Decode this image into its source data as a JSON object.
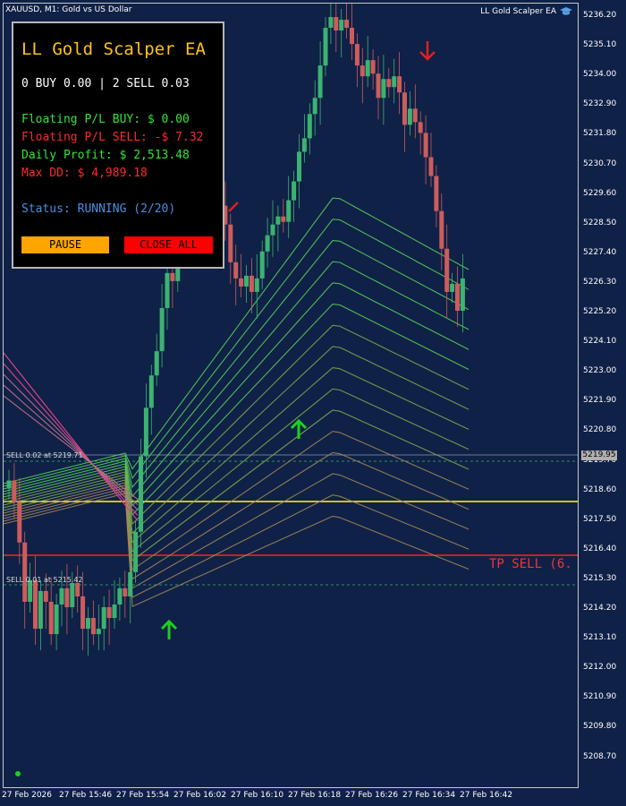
{
  "header": {
    "symbol": "XAUUSD, M1:  Gold vs US Dollar",
    "ea_name": "LL Gold Scalper EA",
    "ea_icon": "graduation-cap-icon"
  },
  "panel": {
    "title": "LL Gold Scalper EA",
    "positions": "0 BUY 0.00 | 2 SELL 0.03",
    "floating_buy": "Floating P/L BUY: $ 0.00",
    "floating_sell": "Floating P/L SELL: -$ 7.32",
    "daily_profit": "Daily Profit: $ 2,513.48",
    "max_dd": "Max DD: $ 4,989.18",
    "status_label": "Status:",
    "status_value": "RUNNING (2/20)",
    "pause_label": "PAUSE",
    "close_all_label": "CLOSE ALL"
  },
  "price_axis": [
    "5236.20",
    "5235.10",
    "5234.00",
    "5232.90",
    "5231.80",
    "5230.70",
    "5229.60",
    "5228.50",
    "5227.40",
    "5226.30",
    "5225.20",
    "5224.10",
    "5223.00",
    "5221.90",
    "5220.80",
    "5219.70",
    "5218.60",
    "5217.50",
    "5216.40",
    "5215.30",
    "5214.20",
    "5213.10",
    "5212.00",
    "5210.90",
    "5209.80",
    "5208.70"
  ],
  "time_axis": [
    "27 Feb 2026",
    "27 Feb 15:46",
    "27 Feb 15:54",
    "27 Feb 16:02",
    "27 Feb 16:10",
    "27 Feb 16:18",
    "27 Feb 16:26",
    "27 Feb 16:34",
    "27 Feb 16:42"
  ],
  "current_price": "5219.95",
  "orders": {
    "sell1": "SELL 0.02 at 5219.71",
    "sell2": "SELL 0.01 at 5215.42",
    "tp_label": "TP SELL (6."
  },
  "colors": {
    "background": "#0f2147",
    "bull": "#3cb371",
    "bear": "#cd5c5c",
    "tp_line": "#ff2020",
    "yellow_line": "#ffff00",
    "gold": "#ffc21a"
  }
}
